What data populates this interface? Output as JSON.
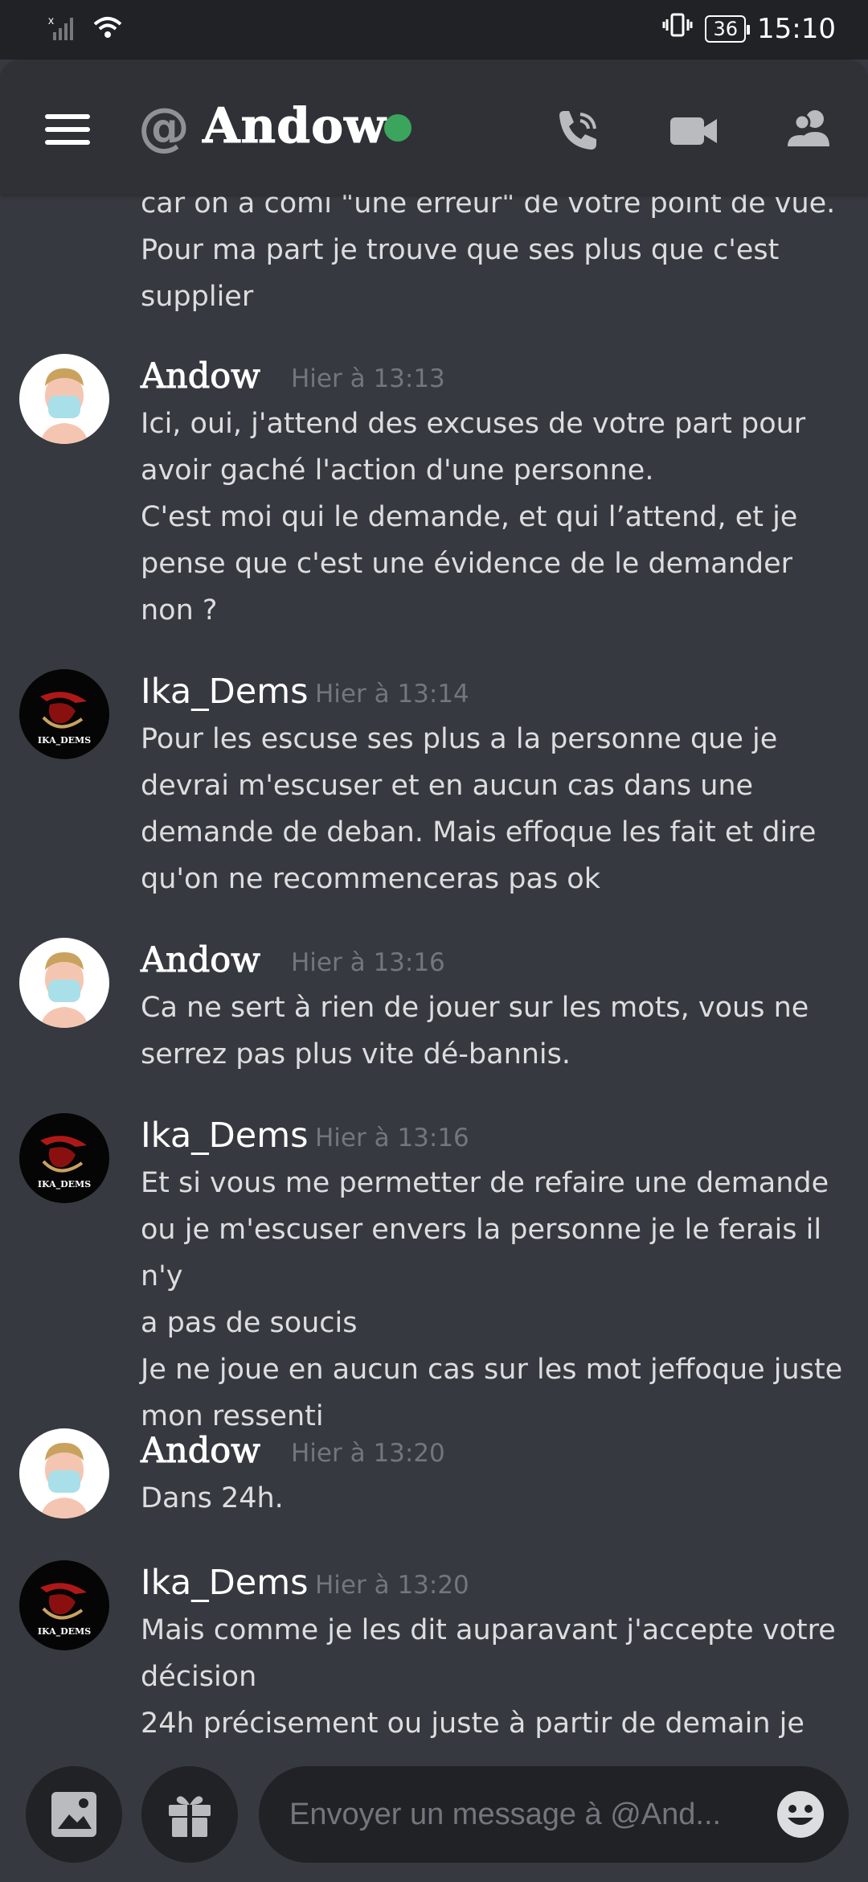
{
  "status_bar": {
    "time": "15:10",
    "battery": "36"
  },
  "header": {
    "at_symbol": "@",
    "channel_name": "Andow"
  },
  "partial_message": {
    "lines": "car on a comi \"une erreur\"  de votre point de vue.\nPour ma part je trouve que ses plus que c'est\nsupplier"
  },
  "messages": [
    {
      "author": "Andow",
      "time": "Hier à 13:13",
      "text": "Ici, oui, j'attend des excuses de votre part pour\navoir gaché l'action d'une personne.\nC'est moi qui le demande, et qui l’attend, et je\npense que c'est une évidence de le demander\nnon ?"
    },
    {
      "author": "Ika_Dems",
      "time": "Hier à 13:14",
      "text": "Pour les escuse ses plus a la personne que je\ndevrai m'escuser et en aucun cas dans une\ndemande de deban. Mais effoque les fait et dire\nqu'on ne recommenceras pas ok"
    },
    {
      "author": "Andow",
      "time": "Hier à 13:16",
      "text": "Ca ne sert à rien de jouer sur les mots, vous ne\nserrez pas plus vite dé-bannis."
    },
    {
      "author": "Ika_Dems",
      "time": "Hier à 13:16",
      "text": "Et si vous me permetter de refaire une demande\nou je m'escuser envers la personne je le ferais il n'y\na pas de soucis\nJe ne joue en aucun cas sur les mot jeffoque juste\nmon ressenti"
    },
    {
      "author": "Andow",
      "time": "Hier à 13:20",
      "text": "Dans 24h."
    },
    {
      "author": "Ika_Dems",
      "time": "Hier à 13:20",
      "text": "Mais comme je les dit auparavant j'accepte votre\ndécision\n24h précisement ou juste à partir de demain je"
    }
  ],
  "avatar_text": {
    "ika": "IKA_DEMS"
  },
  "input": {
    "placeholder": "Envoyer un message à @And..."
  },
  "colors": {
    "background": "#36393f",
    "header": "#2f3136",
    "online": "#3ba55d",
    "timestamp": "#72767d"
  }
}
